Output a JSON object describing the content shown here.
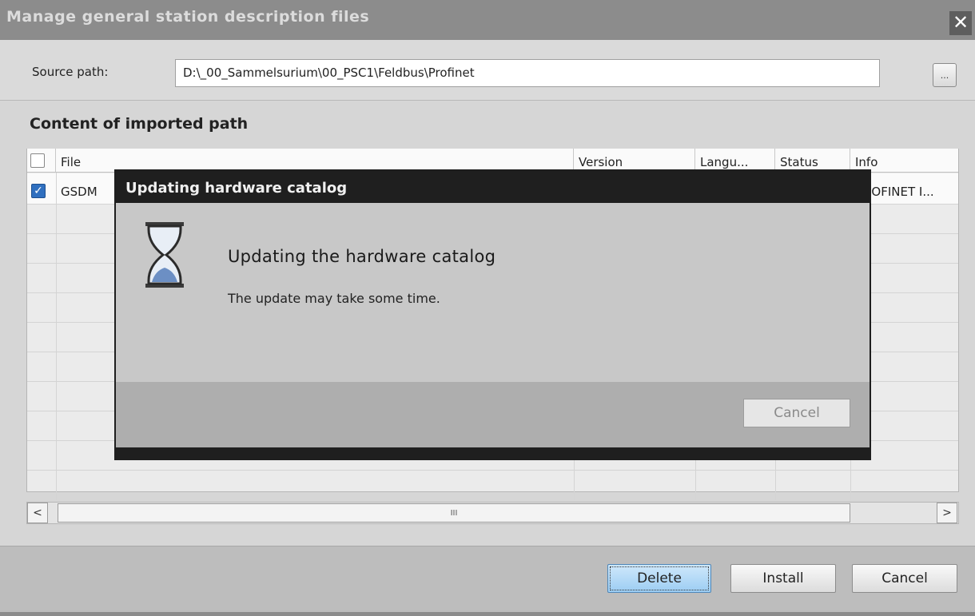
{
  "window": {
    "title": "Manage general station description files",
    "close_glyph": "✕"
  },
  "source": {
    "label": "Source path:",
    "value": "D:\\_00_Sammelsurium\\00_PSC1\\Feldbus\\Profinet",
    "browse_label": "..."
  },
  "content_heading": "Content of imported path",
  "table": {
    "columns": [
      "File",
      "Version",
      "Langu...",
      "Status",
      "Info"
    ],
    "rows": [
      {
        "file": "GSDM",
        "checked": true,
        "info": "ROFINET I..."
      }
    ]
  },
  "scrollbar": {
    "left_glyph": "<",
    "right_glyph": ">",
    "grip": "III"
  },
  "buttons": {
    "delete": "Delete",
    "install": "Install",
    "cancel": "Cancel"
  },
  "dialog": {
    "title": "Updating hardware catalog",
    "heading": "Updating the hardware catalog",
    "message": "The update may take some time.",
    "cancel": "Cancel",
    "icon": "hourglass-icon"
  }
}
